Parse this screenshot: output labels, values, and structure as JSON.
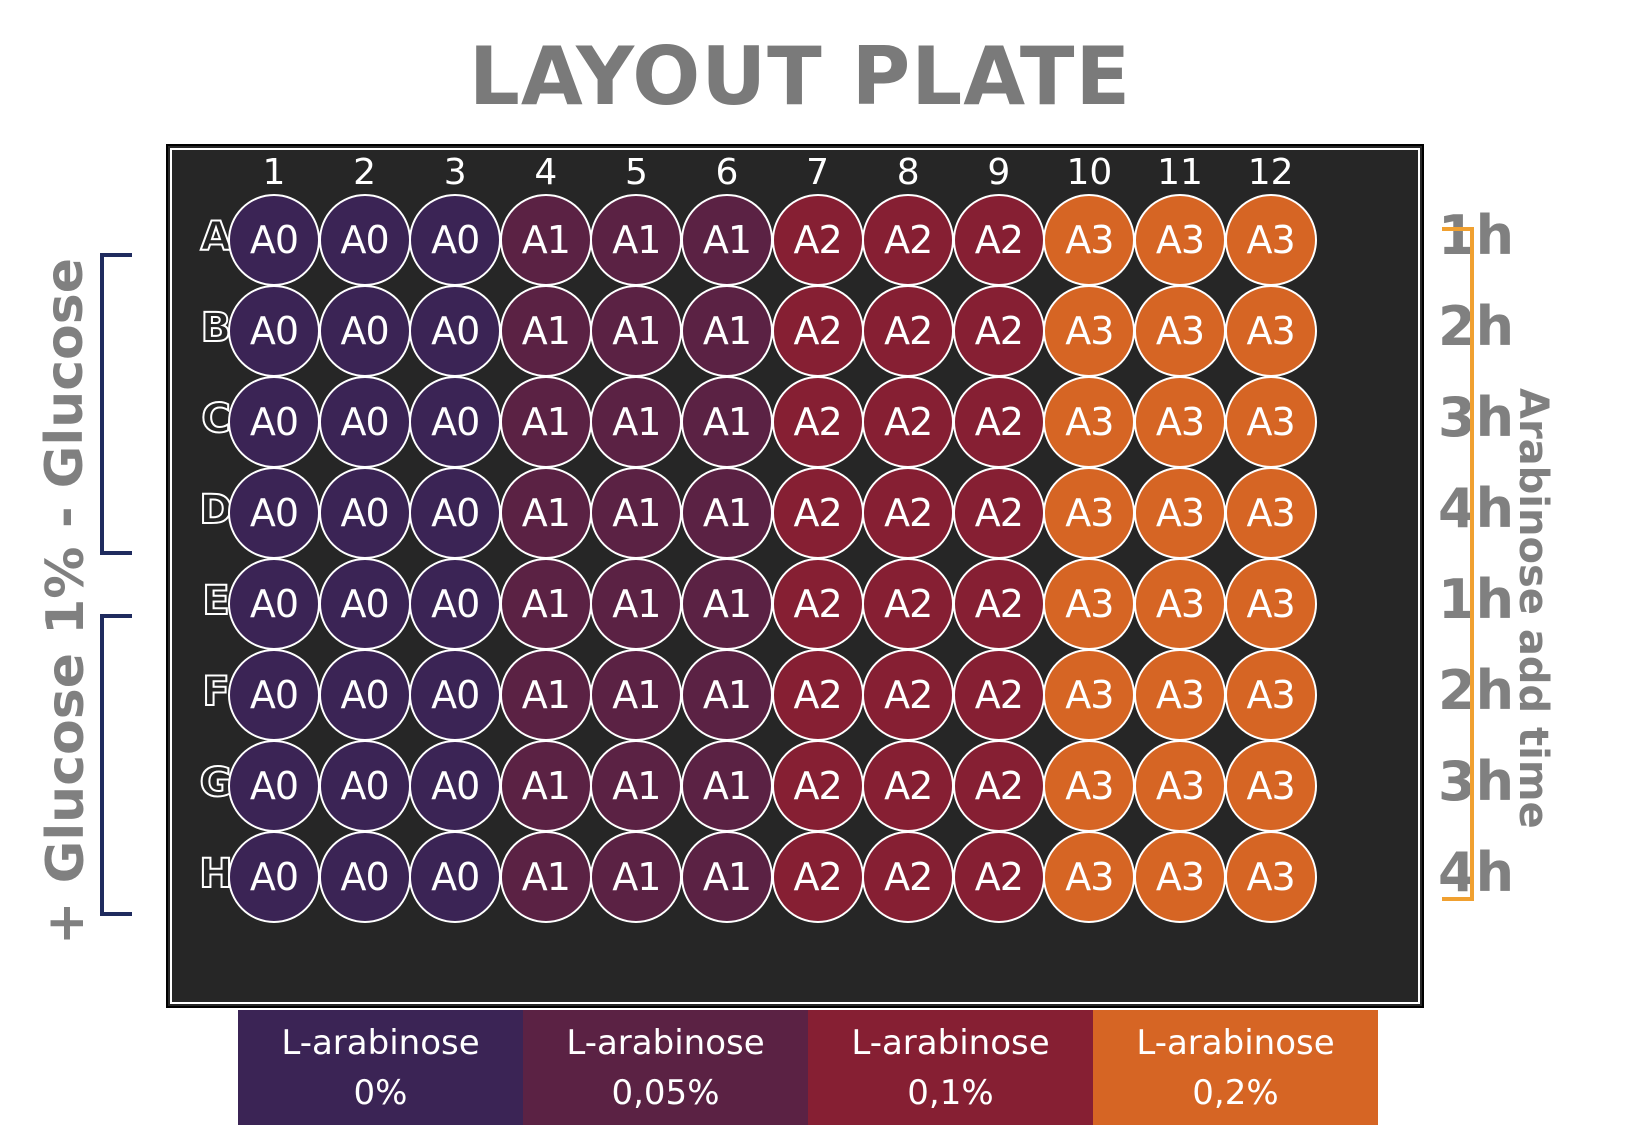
{
  "title": "LAYOUT PLATE",
  "columns": [
    "1",
    "2",
    "3",
    "4",
    "5",
    "6",
    "7",
    "8",
    "9",
    "10",
    "11",
    "12"
  ],
  "rows": [
    {
      "letter": "A",
      "time": "1h"
    },
    {
      "letter": "B",
      "time": "2h"
    },
    {
      "letter": "C",
      "time": "3h"
    },
    {
      "letter": "D",
      "time": "4h"
    },
    {
      "letter": "E",
      "time": "1h"
    },
    {
      "letter": "F",
      "time": "2h"
    },
    {
      "letter": "G",
      "time": "3h"
    },
    {
      "letter": "H",
      "time": "4h"
    }
  ],
  "groups": [
    {
      "code": "A0",
      "color": "#3b2455",
      "columns": [
        1,
        2,
        3
      ],
      "legend_line1": "L-arabinose",
      "legend_line2": "0%"
    },
    {
      "code": "A1",
      "color": "#5b2244",
      "columns": [
        4,
        5,
        6
      ],
      "legend_line1": "L-arabinose",
      "legend_line2": "0,05%"
    },
    {
      "code": "A2",
      "color": "#861f33",
      "columns": [
        7,
        8,
        9
      ],
      "legend_line1": "L-arabinose",
      "legend_line2": "0,1%"
    },
    {
      "code": "A3",
      "color": "#d66524",
      "columns": [
        10,
        11,
        12
      ],
      "legend_line1": "L-arabinose",
      "legend_line2": "0,2%"
    }
  ],
  "left_labels": {
    "top": {
      "text": "- Glucose",
      "bracket_color": "#1f2b5e"
    },
    "bottom": {
      "text": "+ Glucose 1%",
      "bracket_color": "#1f2b5e"
    }
  },
  "right_label": {
    "text": "Arabinose add time",
    "bracket_color": "#f0a030"
  }
}
